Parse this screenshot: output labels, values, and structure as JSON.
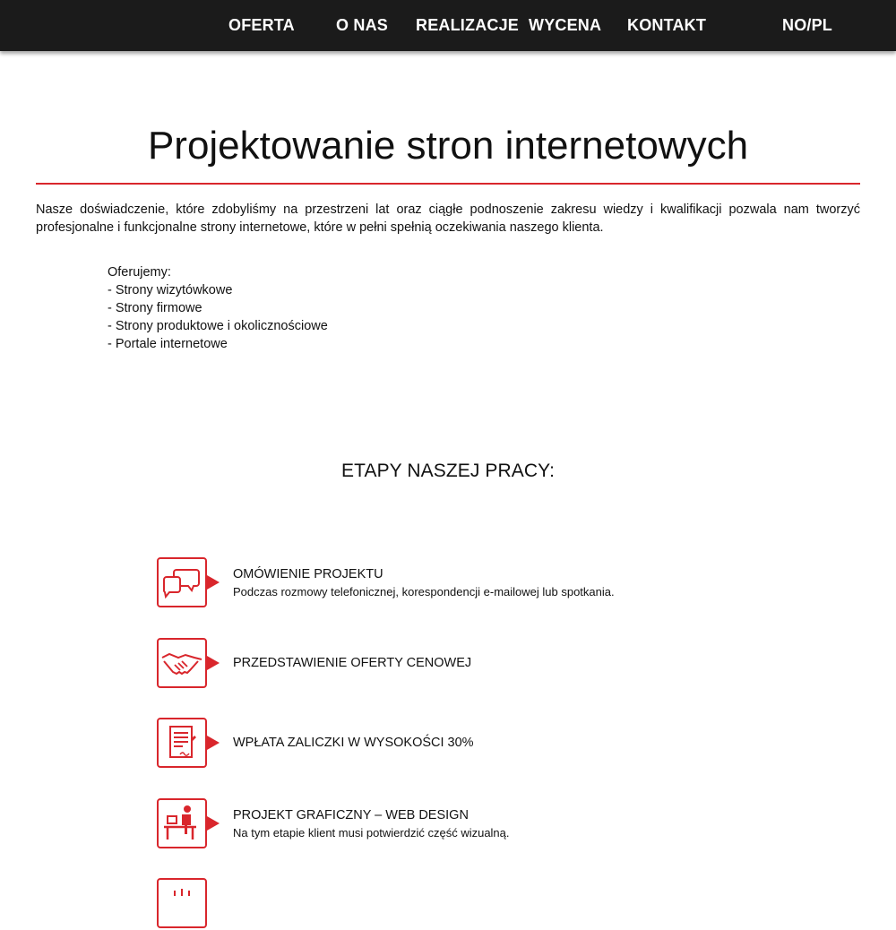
{
  "nav": {
    "items": [
      {
        "label": "OFERTA"
      },
      {
        "label": "O NAS"
      },
      {
        "label": "REALIZACJE"
      },
      {
        "label": "WYCENA"
      },
      {
        "label": "KONTAKT"
      }
    ],
    "language": "NO/PL"
  },
  "main": {
    "title": "Projektowanie stron internetowych",
    "intro": "Nasze doświadczenie, które zdobyliśmy na przestrzeni lat oraz ciągłe podnoszenie zakresu wiedzy i kwalifikacji pozwala nam tworzyć profesjonalne i funkcjonalne strony internetowe, które w pełni spełnią oczekiwania naszego klienta.",
    "offer": {
      "heading": "Oferujemy:",
      "items": [
        "- Strony wizytówkowe",
        "- Strony firmowe",
        "- Strony produktowe i okolicznościowe",
        "- Portale internetowe"
      ]
    },
    "steps_heading": "ETAPY NASZEJ PRACY:",
    "steps": [
      {
        "title": "OMÓWIENIE PROJEKTU",
        "description": "Podczas rozmowy telefonicznej, korespondencji e-mailowej lub spotkania.",
        "icon": "speech-bubbles-icon"
      },
      {
        "title": "PRZEDSTAWIENIE OFERTY CENOWEJ",
        "icon": "handshake-icon"
      },
      {
        "title": "WPŁATA ZALICZKI W WYSOKOŚCI 30%",
        "icon": "signed-document-icon"
      },
      {
        "title": "PROJEKT GRAFICZNY – WEB DESIGN",
        "description": "Na tym etapie klient musi potwierdzić część wizualną.",
        "icon": "designer-at-desk-icon"
      },
      {
        "icon": "step-five-icon"
      }
    ]
  },
  "colors": {
    "nav_background": "#1b1b1b",
    "accent": "#d9262c",
    "text": "#111111",
    "background": "#ffffff"
  }
}
